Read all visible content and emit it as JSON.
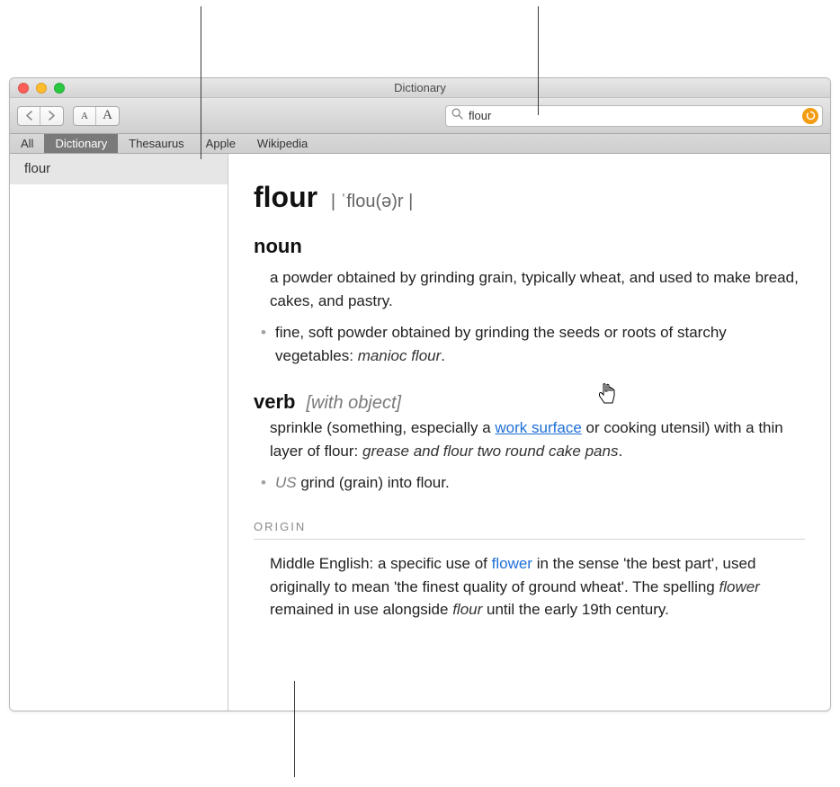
{
  "window": {
    "title": "Dictionary"
  },
  "toolbar": {
    "search": {
      "placeholder": "",
      "value": "flour"
    }
  },
  "tabs": [
    {
      "label": "All",
      "active": false
    },
    {
      "label": "Dictionary",
      "active": true
    },
    {
      "label": "Thesaurus",
      "active": false
    },
    {
      "label": "Apple",
      "active": false
    },
    {
      "label": "Wikipedia",
      "active": false
    }
  ],
  "sidebar": {
    "items": [
      {
        "label": "flour"
      }
    ]
  },
  "entry": {
    "headword": "flour",
    "pronunciation": "| ˈflou(ə)r |",
    "senses": {
      "noun": {
        "pos": "noun",
        "def": "a powder obtained by grinding grain, typically wheat, and used to make bread, cakes, and pastry.",
        "sub": {
          "pre": "fine, soft powder obtained by grinding the seeds or roots of starchy vegetables: ",
          "ex": "manioc flour",
          "post": "."
        }
      },
      "verb": {
        "pos": "verb",
        "grammar": "[with object]",
        "def_pre": "sprinkle (something, especially a ",
        "link": "work surface",
        "def_mid": " or cooking utensil) with a thin layer of flour: ",
        "ex": "grease and flour two round cake pans",
        "def_post": ".",
        "sub": {
          "region": "US",
          "text": " grind (grain) into flour."
        }
      }
    },
    "origin": {
      "header": "ORIGIN",
      "pre": "Middle English: a specific use of ",
      "link": "flower",
      "mid": " in the sense 'the best part', used originally to mean 'the finest quality of ground wheat'. The spelling ",
      "ital1": "flower",
      "mid2": " remained in use alongside ",
      "ital2": "flour",
      "post": " until the early 19th century."
    }
  }
}
